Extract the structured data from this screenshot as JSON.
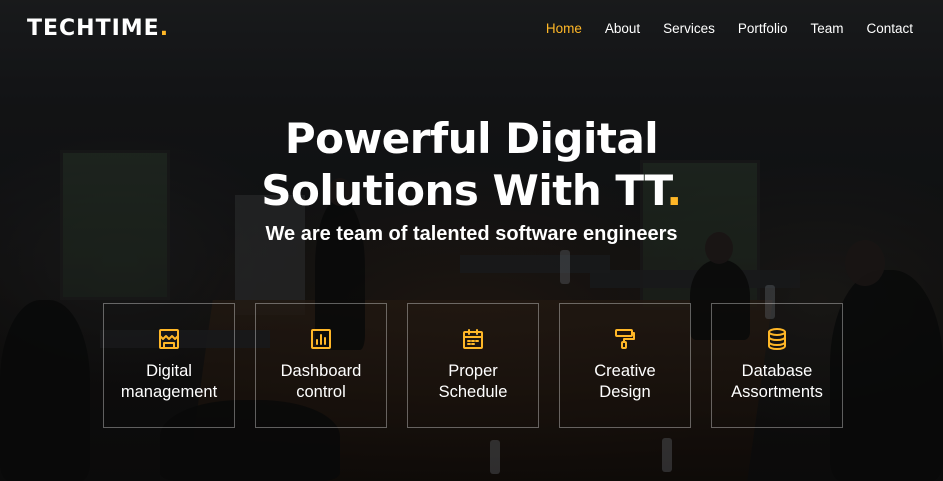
{
  "brand": {
    "name": "TECHTIME",
    "dot": ".",
    "accent_color": "#ffb727"
  },
  "nav": {
    "items": [
      {
        "label": "Home",
        "active": true
      },
      {
        "label": "About",
        "active": false
      },
      {
        "label": "Services",
        "active": false
      },
      {
        "label": "Portfolio",
        "active": false
      },
      {
        "label": "Team",
        "active": false
      },
      {
        "label": "Contact",
        "active": false
      }
    ]
  },
  "hero": {
    "title_line1": "Powerful Digital",
    "title_line2": "Solutions With TT",
    "title_dot": ".",
    "subtitle": "We are team of talented software engineers"
  },
  "features": [
    {
      "icon": "store-icon",
      "line1": "Digital",
      "line2": "management"
    },
    {
      "icon": "bar-chart-icon",
      "line1": "Dashboard",
      "line2": "control"
    },
    {
      "icon": "calendar-icon",
      "line1": "Proper",
      "line2": "Schedule"
    },
    {
      "icon": "paint-roller-icon",
      "line1": "Creative",
      "line2": "Design"
    },
    {
      "icon": "database-icon",
      "line1": "Database",
      "line2": "Assortments"
    }
  ]
}
